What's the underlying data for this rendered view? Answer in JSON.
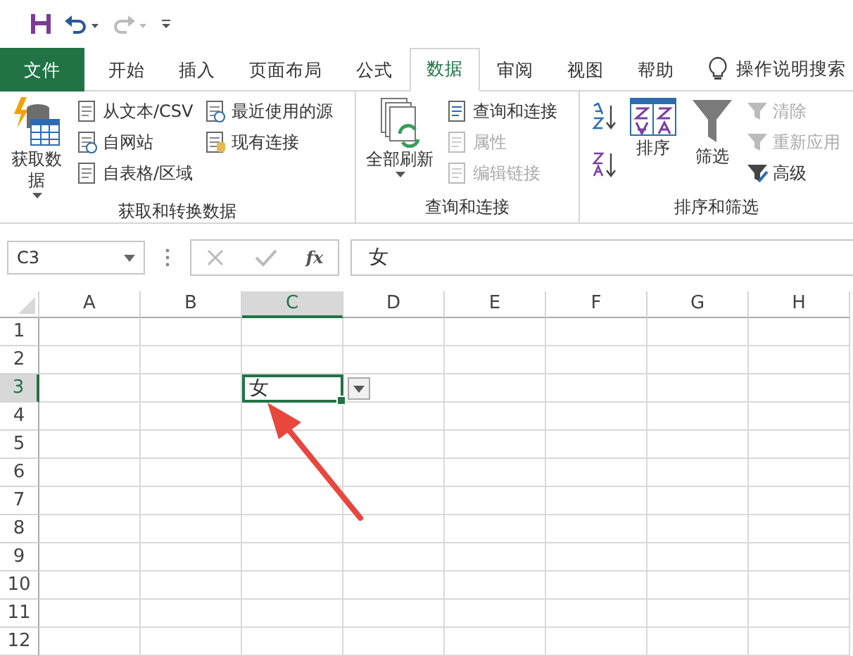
{
  "quick_access": {
    "redo_disabled": true
  },
  "tabs": [
    {
      "label": "文件",
      "kind": "file",
      "selected": false
    },
    {
      "label": "开始",
      "kind": "tab",
      "selected": false
    },
    {
      "label": "插入",
      "kind": "tab",
      "selected": false
    },
    {
      "label": "页面布局",
      "kind": "tab",
      "selected": false
    },
    {
      "label": "公式",
      "kind": "tab",
      "selected": false
    },
    {
      "label": "数据",
      "kind": "tab",
      "selected": true
    },
    {
      "label": "审阅",
      "kind": "tab",
      "selected": false
    },
    {
      "label": "视图",
      "kind": "tab",
      "selected": false
    },
    {
      "label": "帮助",
      "kind": "tab",
      "selected": false
    }
  ],
  "tell_me": {
    "label": "操作说明搜索"
  },
  "ribbon_groups": [
    {
      "title": "获取和转换数据",
      "items": [
        {
          "kind": "large",
          "label": "获取数据",
          "dropdown": true
        },
        {
          "kind": "stack",
          "buttons": [
            {
              "label": "从文本/CSV",
              "disabled": false
            },
            {
              "label": "自网站",
              "disabled": false
            },
            {
              "label": "自表格/区域",
              "disabled": false
            }
          ]
        },
        {
          "kind": "stack",
          "buttons": [
            {
              "label": "最近使用的源",
              "disabled": false
            },
            {
              "label": "现有连接",
              "disabled": false
            }
          ]
        }
      ]
    },
    {
      "title": "查询和连接",
      "items": [
        {
          "kind": "large",
          "label": "全部刷新",
          "dropdown": true
        },
        {
          "kind": "stack",
          "buttons": [
            {
              "label": "查询和连接",
              "disabled": false
            },
            {
              "label": "属性",
              "disabled": true
            },
            {
              "label": "编辑链接",
              "disabled": true
            }
          ]
        }
      ]
    },
    {
      "title": "排序和筛选",
      "items": [
        {
          "kind": "sort_icons"
        },
        {
          "kind": "large",
          "label": "排序",
          "dropdown": false
        },
        {
          "kind": "large",
          "label": "筛选",
          "dropdown": false
        },
        {
          "kind": "stack",
          "buttons": [
            {
              "label": "清除",
              "disabled": true
            },
            {
              "label": "重新应用",
              "disabled": true
            },
            {
              "label": "高级",
              "disabled": false
            }
          ]
        }
      ]
    }
  ],
  "name_box": {
    "value": "C3"
  },
  "formula_bar": {
    "function_label": "fx",
    "value": "女"
  },
  "columns": [
    {
      "label": "A",
      "selected": false
    },
    {
      "label": "B",
      "selected": false
    },
    {
      "label": "C",
      "selected": true
    },
    {
      "label": "D",
      "selected": false
    },
    {
      "label": "E",
      "selected": false
    },
    {
      "label": "F",
      "selected": false
    },
    {
      "label": "G",
      "selected": false
    },
    {
      "label": "H",
      "selected": false
    }
  ],
  "rows": [
    {
      "label": "1",
      "selected": false,
      "cells": []
    },
    {
      "label": "2",
      "selected": false,
      "cells": []
    },
    {
      "label": "3",
      "selected": true,
      "cells": [
        null,
        null,
        "女"
      ],
      "dropdown": true
    },
    {
      "label": "4",
      "selected": false,
      "cells": []
    },
    {
      "label": "5",
      "selected": false,
      "cells": []
    },
    {
      "label": "6",
      "selected": false,
      "cells": []
    },
    {
      "label": "7",
      "selected": false,
      "cells": []
    },
    {
      "label": "8",
      "selected": false,
      "cells": []
    },
    {
      "label": "9",
      "selected": false,
      "cells": []
    },
    {
      "label": "10",
      "selected": false,
      "cells": []
    },
    {
      "label": "11",
      "selected": false,
      "cells": []
    },
    {
      "label": "12",
      "selected": false,
      "cells": []
    }
  ]
}
